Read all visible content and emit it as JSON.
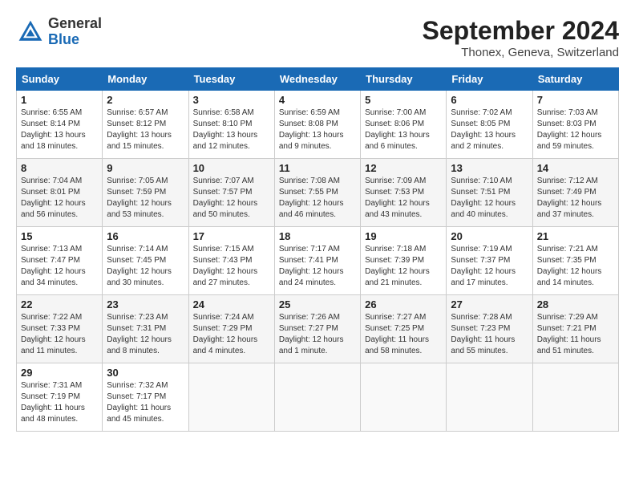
{
  "header": {
    "logo_general": "General",
    "logo_blue": "Blue",
    "month_title": "September 2024",
    "location": "Thonex, Geneva, Switzerland"
  },
  "days_of_week": [
    "Sunday",
    "Monday",
    "Tuesday",
    "Wednesday",
    "Thursday",
    "Friday",
    "Saturday"
  ],
  "weeks": [
    [
      {
        "day": "1",
        "info": "Sunrise: 6:55 AM\nSunset: 8:14 PM\nDaylight: 13 hours\nand 18 minutes."
      },
      {
        "day": "2",
        "info": "Sunrise: 6:57 AM\nSunset: 8:12 PM\nDaylight: 13 hours\nand 15 minutes."
      },
      {
        "day": "3",
        "info": "Sunrise: 6:58 AM\nSunset: 8:10 PM\nDaylight: 13 hours\nand 12 minutes."
      },
      {
        "day": "4",
        "info": "Sunrise: 6:59 AM\nSunset: 8:08 PM\nDaylight: 13 hours\nand 9 minutes."
      },
      {
        "day": "5",
        "info": "Sunrise: 7:00 AM\nSunset: 8:06 PM\nDaylight: 13 hours\nand 6 minutes."
      },
      {
        "day": "6",
        "info": "Sunrise: 7:02 AM\nSunset: 8:05 PM\nDaylight: 13 hours\nand 2 minutes."
      },
      {
        "day": "7",
        "info": "Sunrise: 7:03 AM\nSunset: 8:03 PM\nDaylight: 12 hours\nand 59 minutes."
      }
    ],
    [
      {
        "day": "8",
        "info": "Sunrise: 7:04 AM\nSunset: 8:01 PM\nDaylight: 12 hours\nand 56 minutes."
      },
      {
        "day": "9",
        "info": "Sunrise: 7:05 AM\nSunset: 7:59 PM\nDaylight: 12 hours\nand 53 minutes."
      },
      {
        "day": "10",
        "info": "Sunrise: 7:07 AM\nSunset: 7:57 PM\nDaylight: 12 hours\nand 50 minutes."
      },
      {
        "day": "11",
        "info": "Sunrise: 7:08 AM\nSunset: 7:55 PM\nDaylight: 12 hours\nand 46 minutes."
      },
      {
        "day": "12",
        "info": "Sunrise: 7:09 AM\nSunset: 7:53 PM\nDaylight: 12 hours\nand 43 minutes."
      },
      {
        "day": "13",
        "info": "Sunrise: 7:10 AM\nSunset: 7:51 PM\nDaylight: 12 hours\nand 40 minutes."
      },
      {
        "day": "14",
        "info": "Sunrise: 7:12 AM\nSunset: 7:49 PM\nDaylight: 12 hours\nand 37 minutes."
      }
    ],
    [
      {
        "day": "15",
        "info": "Sunrise: 7:13 AM\nSunset: 7:47 PM\nDaylight: 12 hours\nand 34 minutes."
      },
      {
        "day": "16",
        "info": "Sunrise: 7:14 AM\nSunset: 7:45 PM\nDaylight: 12 hours\nand 30 minutes."
      },
      {
        "day": "17",
        "info": "Sunrise: 7:15 AM\nSunset: 7:43 PM\nDaylight: 12 hours\nand 27 minutes."
      },
      {
        "day": "18",
        "info": "Sunrise: 7:17 AM\nSunset: 7:41 PM\nDaylight: 12 hours\nand 24 minutes."
      },
      {
        "day": "19",
        "info": "Sunrise: 7:18 AM\nSunset: 7:39 PM\nDaylight: 12 hours\nand 21 minutes."
      },
      {
        "day": "20",
        "info": "Sunrise: 7:19 AM\nSunset: 7:37 PM\nDaylight: 12 hours\nand 17 minutes."
      },
      {
        "day": "21",
        "info": "Sunrise: 7:21 AM\nSunset: 7:35 PM\nDaylight: 12 hours\nand 14 minutes."
      }
    ],
    [
      {
        "day": "22",
        "info": "Sunrise: 7:22 AM\nSunset: 7:33 PM\nDaylight: 12 hours\nand 11 minutes."
      },
      {
        "day": "23",
        "info": "Sunrise: 7:23 AM\nSunset: 7:31 PM\nDaylight: 12 hours\nand 8 minutes."
      },
      {
        "day": "24",
        "info": "Sunrise: 7:24 AM\nSunset: 7:29 PM\nDaylight: 12 hours\nand 4 minutes."
      },
      {
        "day": "25",
        "info": "Sunrise: 7:26 AM\nSunset: 7:27 PM\nDaylight: 12 hours\nand 1 minute."
      },
      {
        "day": "26",
        "info": "Sunrise: 7:27 AM\nSunset: 7:25 PM\nDaylight: 11 hours\nand 58 minutes."
      },
      {
        "day": "27",
        "info": "Sunrise: 7:28 AM\nSunset: 7:23 PM\nDaylight: 11 hours\nand 55 minutes."
      },
      {
        "day": "28",
        "info": "Sunrise: 7:29 AM\nSunset: 7:21 PM\nDaylight: 11 hours\nand 51 minutes."
      }
    ],
    [
      {
        "day": "29",
        "info": "Sunrise: 7:31 AM\nSunset: 7:19 PM\nDaylight: 11 hours\nand 48 minutes."
      },
      {
        "day": "30",
        "info": "Sunrise: 7:32 AM\nSunset: 7:17 PM\nDaylight: 11 hours\nand 45 minutes."
      },
      {
        "day": "",
        "info": ""
      },
      {
        "day": "",
        "info": ""
      },
      {
        "day": "",
        "info": ""
      },
      {
        "day": "",
        "info": ""
      },
      {
        "day": "",
        "info": ""
      }
    ]
  ]
}
